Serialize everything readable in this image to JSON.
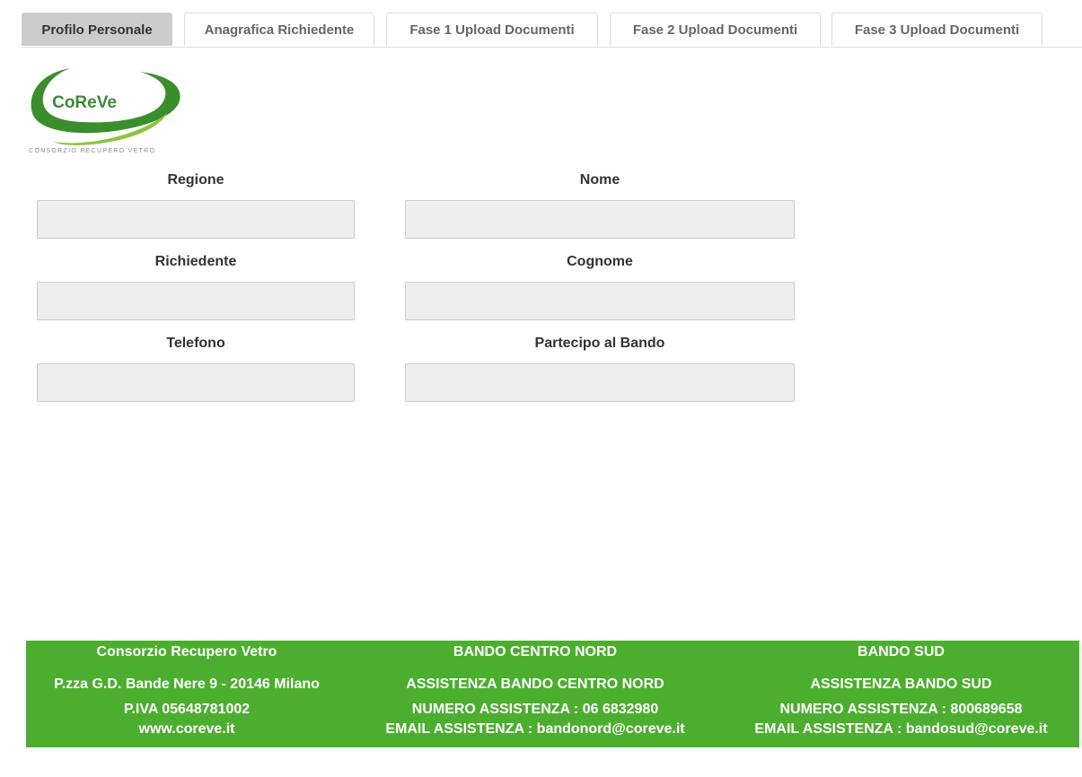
{
  "tabs": [
    {
      "label": "Profilo Personale",
      "active": true
    },
    {
      "label": "Anagrafica Richiedente",
      "active": false
    },
    {
      "label": "Fase 1 Upload Documenti",
      "active": false
    },
    {
      "label": "Fase 2 Upload Documenti",
      "active": false
    },
    {
      "label": "Fase 3 Upload Documenti",
      "active": false
    }
  ],
  "logo": {
    "text": "CoReVe",
    "tagline": "CONSORZIO RECUPERO VETRO",
    "colors": {
      "dark": "#3a8e2c",
      "light": "#8cc63f",
      "text": "#3b8a3a"
    }
  },
  "form": {
    "regione": {
      "label": "Regione",
      "value": ""
    },
    "nome": {
      "label": "Nome",
      "value": ""
    },
    "richiedente": {
      "label": "Richiedente",
      "value": ""
    },
    "cognome": {
      "label": "Cognome",
      "value": ""
    },
    "telefono": {
      "label": "Telefono",
      "value": ""
    },
    "partecipo": {
      "label": "Partecipo al Bando",
      "value": ""
    }
  },
  "footer": {
    "background": "#4cae2f",
    "col1": {
      "title": "Consorzio Recupero Vetro",
      "address": "P.zza G.D. Bande Nere 9 - 20146 Milano",
      "piva": "P.IVA 05648781002",
      "website": "www.coreve.it"
    },
    "col2": {
      "title": "BANDO CENTRO NORD",
      "subtitle": "ASSISTENZA BANDO CENTRO NORD",
      "phone": "NUMERO ASSISTENZA : 06 6832980",
      "email": "EMAIL ASSISTENZA : bandonord@coreve.it"
    },
    "col3": {
      "title": "BANDO SUD",
      "subtitle": "ASSISTENZA BANDO SUD",
      "phone": "NUMERO ASSISTENZA : 800689658",
      "email": "EMAIL ASSISTENZA : bandosud@coreve.it"
    }
  }
}
